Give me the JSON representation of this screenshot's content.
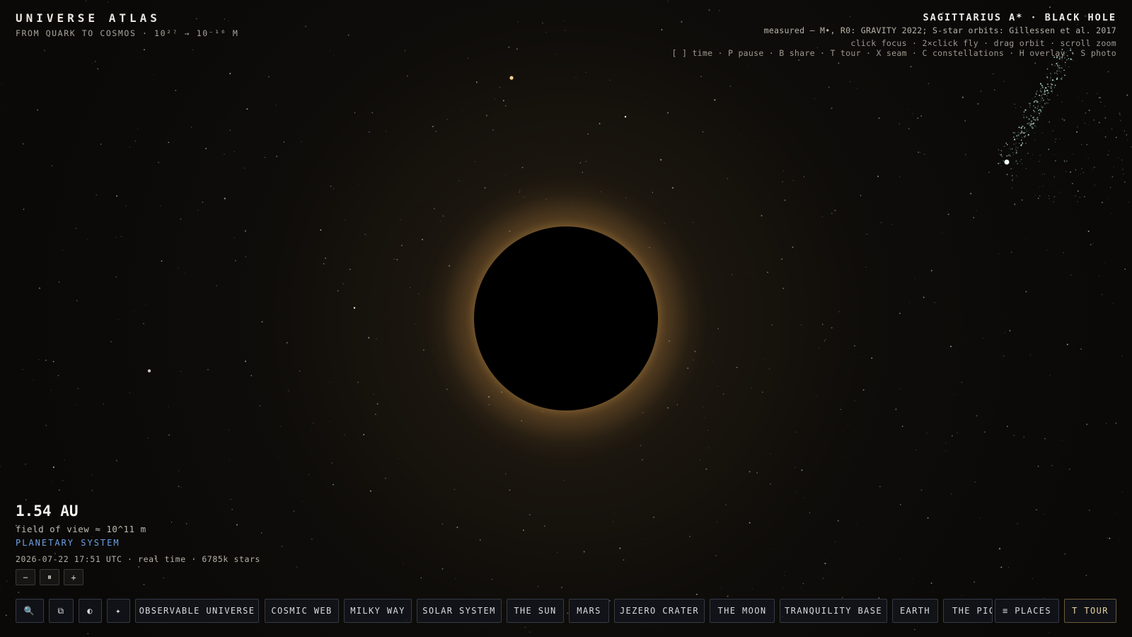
{
  "app": {
    "title": "UNIVERSE ATLAS",
    "subtitle": "FROM QUARK TO COSMOS · 10²⁷ → 10⁻¹⁶ M"
  },
  "object": {
    "title": "SAGITTARIUS A* · BLACK HOLE",
    "source": "measured — M•, R0: GRAVITY 2022; S-star orbits: Gillessen et al. 2017",
    "hint_mouse": "click focus · 2×click fly · drag orbit · scroll zoom",
    "hint_keys": "[ ] time · P pause · B share · T tour · X seam · C constellations · H overlay · S photo"
  },
  "readout": {
    "distance": "1.54 AU",
    "fov": "field of view ≈ 10^11 m",
    "scale_name": "PLANETARY SYSTEM",
    "timeline": "2026-07-22 17:51 UTC · real time · 6785k stars"
  },
  "time_controls": {
    "slower": "−",
    "pause": "⏸",
    "faster": "+"
  },
  "toolbar": {
    "search_icon": "🔍",
    "copy_icon": "⧉",
    "contrast_icon": "◐",
    "star_icon": "✦"
  },
  "places": [
    "OBSERVABLE UNIVERSE",
    "COSMIC WEB",
    "MILKY WAY",
    "SOLAR SYSTEM",
    "THE SUN",
    "MARS",
    "JEZERO CRATER",
    "THE MOON",
    "TRANQUILITY BASE",
    "EARTH",
    "THE PICT"
  ],
  "places_button": "≡ PLACES",
  "tour_button": "T TOUR",
  "colors": {
    "accent_blue": "#6ea0e0",
    "tour_gold": "#e8d3a0",
    "accretion_glow": "#d6a050"
  }
}
